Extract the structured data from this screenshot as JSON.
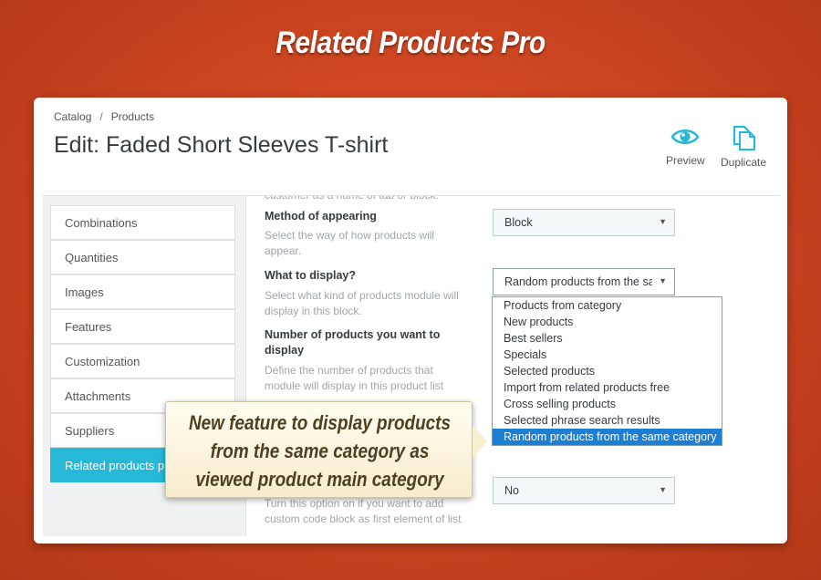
{
  "banner": {
    "title": "Related Products Pro"
  },
  "header": {
    "breadcrumb": [
      "Catalog",
      "Products"
    ],
    "breadcrumb_sep": "/",
    "title": "Edit: Faded Short Sleeves T-shirt",
    "actions": [
      {
        "label": "Preview",
        "icon": "eye-icon"
      },
      {
        "label": "Duplicate",
        "icon": "duplicate-icon"
      }
    ]
  },
  "tabs": [
    {
      "label": "Combinations"
    },
    {
      "label": "Quantities"
    },
    {
      "label": "Images"
    },
    {
      "label": "Features"
    },
    {
      "label": "Customization"
    },
    {
      "label": "Attachments"
    },
    {
      "label": "Suppliers"
    },
    {
      "label": "Related products pro",
      "active": true
    }
  ],
  "form": {
    "cut_off_help": "customer as a name of tab or block.",
    "method": {
      "label": "Method of appearing",
      "help": "Select the way of how products will appear.",
      "value": "Block"
    },
    "what": {
      "label": "What to display?",
      "help": "Select what kind of products module will display in this block.",
      "value": "Random products from the same category",
      "options": [
        "Products from category",
        "New products",
        "Best sellers",
        "Specials",
        "Selected products",
        "Import from related products free",
        "Cross selling products",
        "Selected phrase search results",
        "Random products from the same category"
      ],
      "selected_index": 8
    },
    "count": {
      "label": "Number of products you want to display",
      "help": "Define the number of products that module will display in this product list"
    },
    "custom": {
      "help": "Turn this option on if you want to add custom code block as first element of list",
      "value": "No"
    }
  },
  "callout": {
    "text": "New feature to display products from the same category as viewed product main category"
  },
  "colors": {
    "accent": "#25b9d7",
    "background": "#cd4622",
    "highlight": "#1e7fd2"
  }
}
